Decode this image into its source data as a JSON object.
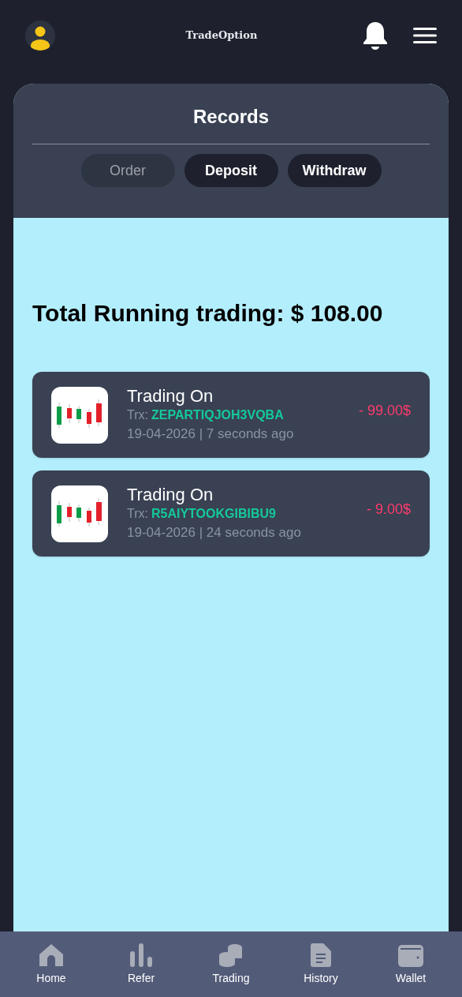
{
  "header": {
    "brand": "TradeOption"
  },
  "records": {
    "title": "Records",
    "tabs": [
      {
        "label": "Order",
        "selected": true
      },
      {
        "label": "Deposit",
        "selected": false
      },
      {
        "label": "Withdraw",
        "selected": false
      }
    ],
    "total": "Total Running trading: $ 108.00",
    "items": [
      {
        "title": "Trading On",
        "trx_label": "Trx:",
        "trx": "ZEPARTIQJOH3VQBA",
        "time": "19-04-2026 | 7 seconds ago",
        "amount": "- 99.00$"
      },
      {
        "title": "Trading On",
        "trx_label": "Trx:",
        "trx": "R5AIYTOOKGIBIBU9",
        "time": "19-04-2026 | 24 seconds ago",
        "amount": "- 9.00$"
      }
    ]
  },
  "nav": [
    {
      "label": "Home",
      "kind": "home"
    },
    {
      "label": "Refer",
      "kind": "refer"
    },
    {
      "label": "Trading",
      "kind": "trading"
    },
    {
      "label": "History",
      "kind": "history"
    },
    {
      "label": "Wallet",
      "kind": "wallet"
    }
  ]
}
